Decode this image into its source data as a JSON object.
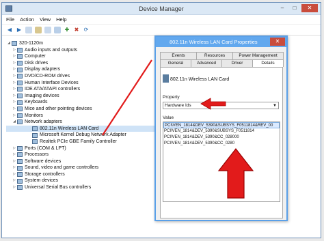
{
  "window": {
    "title": "Device Manager",
    "min": "–",
    "max": "□",
    "close": "✕"
  },
  "menu": [
    "File",
    "Action",
    "View",
    "Help"
  ],
  "toolbar": [
    "back-icon",
    "forward-icon",
    "properties-icon",
    "help-icon",
    "show-icon",
    "update-driver-icon",
    "disable-icon",
    "uninstall-icon",
    "scan-icon"
  ],
  "tree": [
    {
      "label": "320-1120m",
      "level": 0,
      "exp": "◢"
    },
    {
      "label": "Audio inputs and outputs",
      "level": 1,
      "exp": "▷"
    },
    {
      "label": "Computer",
      "level": 1,
      "exp": "▷"
    },
    {
      "label": "Disk drives",
      "level": 1,
      "exp": "▷"
    },
    {
      "label": "Display adapters",
      "level": 1,
      "exp": "▷"
    },
    {
      "label": "DVD/CD-ROM drives",
      "level": 1,
      "exp": "▷"
    },
    {
      "label": "Human Interface Devices",
      "level": 1,
      "exp": "▷"
    },
    {
      "label": "IDE ATA/ATAPI controllers",
      "level": 1,
      "exp": "▷"
    },
    {
      "label": "Imaging devices",
      "level": 1,
      "exp": "▷"
    },
    {
      "label": "Keyboards",
      "level": 1,
      "exp": "▷"
    },
    {
      "label": "Mice and other pointing devices",
      "level": 1,
      "exp": "▷"
    },
    {
      "label": "Monitors",
      "level": 1,
      "exp": "▷"
    },
    {
      "label": "Network adapters",
      "level": 1,
      "exp": "◢"
    },
    {
      "label": "802.11n Wireless LAN Card",
      "level": 2,
      "exp": ""
    },
    {
      "label": "Microsoft Kernel Debug Network Adapter",
      "level": 2,
      "exp": ""
    },
    {
      "label": "Realtek PCIe GBE Family Controller",
      "level": 2,
      "exp": ""
    },
    {
      "label": "Ports (COM & LPT)",
      "level": 1,
      "exp": "▷"
    },
    {
      "label": "Processors",
      "level": 1,
      "exp": "▷"
    },
    {
      "label": "Software devices",
      "level": 1,
      "exp": "▷"
    },
    {
      "label": "Sound, video and game controllers",
      "level": 1,
      "exp": "▷"
    },
    {
      "label": "Storage controllers",
      "level": 1,
      "exp": "▷"
    },
    {
      "label": "System devices",
      "level": 1,
      "exp": "▷"
    },
    {
      "label": "Universal Serial Bus controllers",
      "level": 1,
      "exp": "▷"
    }
  ],
  "dialog": {
    "title": "802.11n Wireless LAN Card Properties",
    "close": "✕",
    "tabs_top": [
      "Events",
      "Resources",
      "Power Management"
    ],
    "tabs_bottom": [
      "General",
      "Advanced",
      "Driver",
      "Details"
    ],
    "device_name": "802.11n Wireless LAN Card",
    "property_label": "Property",
    "property_value": "Hardware Ids",
    "value_label": "Value",
    "values": [
      "PCI\\VEN_1814&DEV_5390&SUBSYS_F0511814&REV_00",
      "PCI\\VEN_1814&DEV_5390&SUBSYS_F0511814",
      "PCI\\VEN_1814&DEV_5390&CC_028000",
      "PCI\\VEN_1814&DEV_5390&CC_0280"
    ]
  },
  "colors": {
    "annotation": "#e21b1b",
    "dialog_title": "#62a8ee"
  }
}
